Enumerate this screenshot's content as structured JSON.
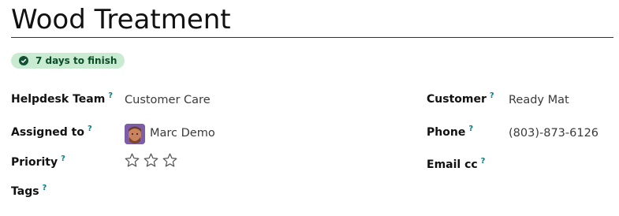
{
  "title": "Wood Treatment",
  "badge": {
    "text": "7 days to finish",
    "icon": "check-circle-icon",
    "color": "#c8ebd2"
  },
  "fields": {
    "helpdesk_team": {
      "label": "Helpdesk Team",
      "help": "?",
      "value": "Customer Care"
    },
    "assigned_to": {
      "label": "Assigned to",
      "help": "?",
      "value": "Marc Demo",
      "avatar": "user-avatar"
    },
    "priority": {
      "label": "Priority",
      "help": "?",
      "stars_total": 3,
      "stars_filled": 0
    },
    "tags": {
      "label": "Tags",
      "help": "?"
    },
    "customer": {
      "label": "Customer",
      "help": "?",
      "value": "Ready Mat"
    },
    "phone": {
      "label": "Phone",
      "help": "?",
      "value": "(803)-873-6126"
    },
    "email_cc": {
      "label": "Email cc",
      "help": "?"
    }
  }
}
